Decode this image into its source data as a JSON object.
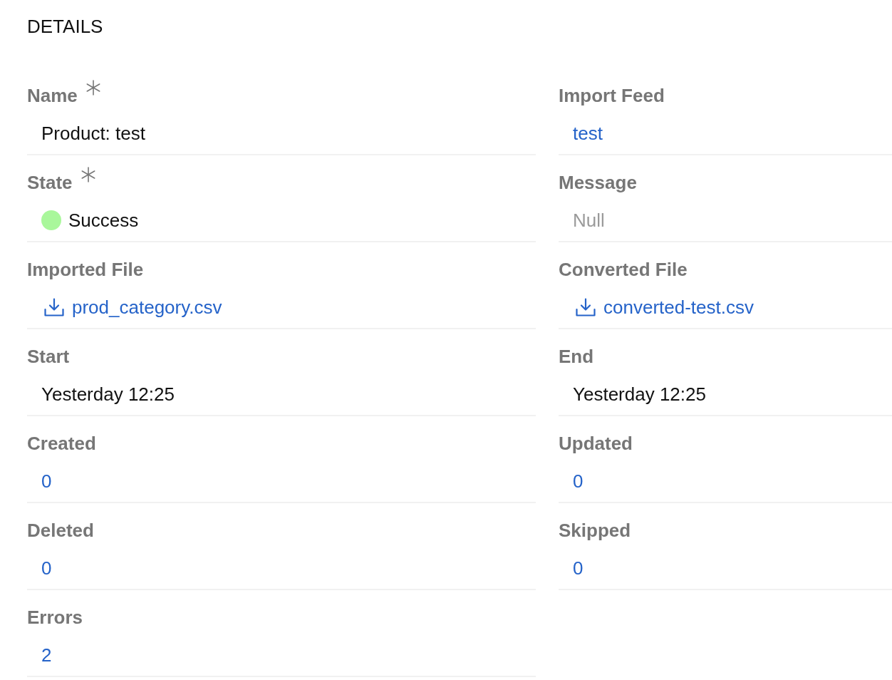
{
  "title": "DETAILS",
  "fields": [
    {
      "label": "Name",
      "required": true,
      "value": {
        "kind": "text",
        "text": "Product: test"
      }
    },
    {
      "label": "Import Feed",
      "required": false,
      "value": {
        "kind": "link",
        "text": "test"
      }
    },
    {
      "label": "State",
      "required": true,
      "value": {
        "kind": "status",
        "text": "Success",
        "color": "#a9f79b"
      }
    },
    {
      "label": "Message",
      "required": false,
      "value": {
        "kind": "empty",
        "text": "Null"
      }
    },
    {
      "label": "Imported File",
      "required": false,
      "value": {
        "kind": "file",
        "text": "prod_category.csv"
      }
    },
    {
      "label": "Converted File",
      "required": false,
      "value": {
        "kind": "file",
        "text": "converted-test.csv"
      }
    },
    {
      "label": "Start",
      "required": false,
      "value": {
        "kind": "text",
        "text": "Yesterday 12:25"
      }
    },
    {
      "label": "End",
      "required": false,
      "value": {
        "kind": "text",
        "text": "Yesterday 12:25"
      }
    },
    {
      "label": "Created",
      "required": false,
      "value": {
        "kind": "link",
        "text": "0"
      }
    },
    {
      "label": "Updated",
      "required": false,
      "value": {
        "kind": "link",
        "text": "0"
      }
    },
    {
      "label": "Deleted",
      "required": false,
      "value": {
        "kind": "link",
        "text": "0"
      }
    },
    {
      "label": "Skipped",
      "required": false,
      "value": {
        "kind": "link",
        "text": "0"
      }
    },
    {
      "label": "Errors",
      "required": false,
      "value": {
        "kind": "link",
        "text": "2"
      }
    }
  ]
}
